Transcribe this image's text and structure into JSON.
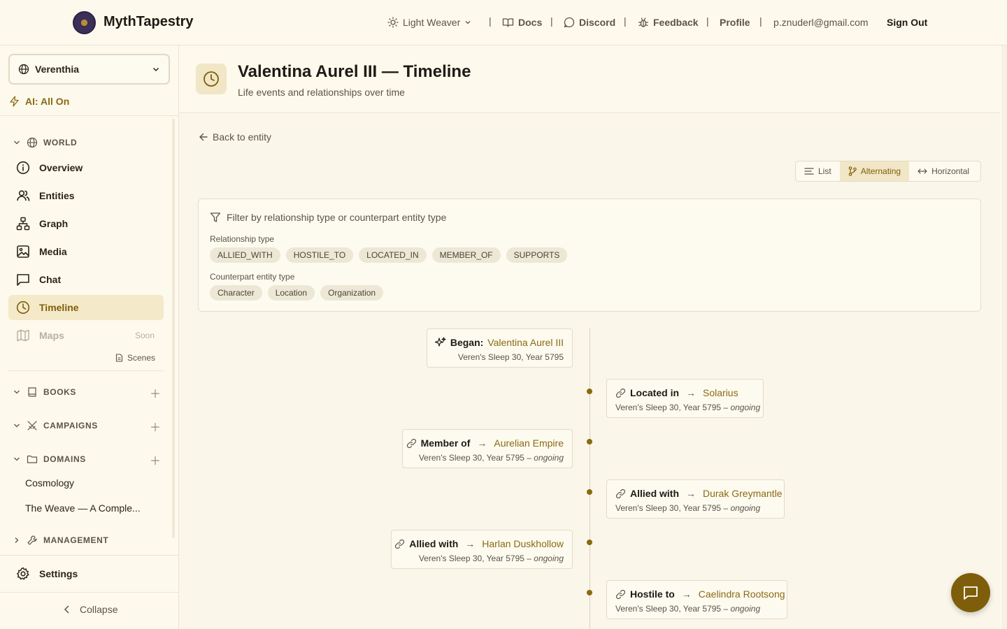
{
  "brand": {
    "name": "MythTapestry"
  },
  "topnav": {
    "theme": "Light Weaver",
    "docs": "Docs",
    "discord": "Discord",
    "feedback": "Feedback",
    "profile": "Profile",
    "email": "p.znuderl@gmail.com",
    "signout": "Sign Out",
    "separator": "|"
  },
  "sidebar": {
    "world": "Verenthia",
    "ai": "AI: All On",
    "world_section": "WORLD",
    "items": [
      {
        "label": "Overview",
        "icon": "info-icon"
      },
      {
        "label": "Entities",
        "icon": "users-icon"
      },
      {
        "label": "Graph",
        "icon": "graph-icon"
      },
      {
        "label": "Media",
        "icon": "image-icon"
      },
      {
        "label": "Chat",
        "icon": "chat-icon"
      },
      {
        "label": "Timeline",
        "icon": "clock-icon"
      },
      {
        "label": "Maps",
        "icon": "map-icon",
        "badge": "Soon"
      }
    ],
    "scenes": "Scenes",
    "books": "BOOKS",
    "campaigns": "CAMPAIGNS",
    "domains": "DOMAINS",
    "domain_items": [
      "Cosmology",
      "The Weave — A Comple..."
    ],
    "management": "MANAGEMENT",
    "settings": "Settings",
    "collapse": "Collapse"
  },
  "header": {
    "title": "Valentina Aurel III — Timeline",
    "subtitle": "Life events and relationships over time"
  },
  "back_link": "Back to entity",
  "view_modes": {
    "list": "List",
    "alternating": "Alternating",
    "horizontal": "Horizontal",
    "active": "Alternating"
  },
  "filter": {
    "title": "Filter by relationship type or counterpart entity type",
    "relationship_label": "Relationship type",
    "relationship_types": [
      "ALLIED_WITH",
      "HOSTILE_TO",
      "LOCATED_IN",
      "MEMBER_OF",
      "SUPPORTS"
    ],
    "entity_label": "Counterpart entity type",
    "entity_types": [
      "Character",
      "Location",
      "Organization"
    ]
  },
  "timeline": {
    "events": [
      {
        "side": "left",
        "kind": "Began:",
        "target": "Valentina Aurel III",
        "date": "Veren's Sleep 30, Year 5795",
        "ongoing": "",
        "icon": "sparkles-icon"
      },
      {
        "side": "right",
        "kind": "Located in",
        "arrow": "→",
        "target": "Solarius",
        "date": "Veren's Sleep 30, Year 5795 –",
        "ongoing": "ongoing",
        "icon": "link-icon"
      },
      {
        "side": "left",
        "kind": "Member of",
        "arrow": "→",
        "target": "Aurelian Empire",
        "date": "Veren's Sleep 30, Year 5795 –",
        "ongoing": "ongoing",
        "icon": "link-icon"
      },
      {
        "side": "right",
        "kind": "Allied with",
        "arrow": "→",
        "target": "Durak Greymantle",
        "date": "Veren's Sleep 30, Year 5795 –",
        "ongoing": "ongoing",
        "icon": "link-icon"
      },
      {
        "side": "left",
        "kind": "Allied with",
        "arrow": "→",
        "target": "Harlan Duskhollow",
        "date": "Veren's Sleep 30, Year 5795 –",
        "ongoing": "ongoing",
        "icon": "link-icon"
      },
      {
        "side": "right",
        "kind": "Hostile to",
        "arrow": "→",
        "target": "Caelindra Rootsong",
        "date": "Veren's Sleep 30, Year 5795 –",
        "ongoing": "ongoing",
        "icon": "link-icon"
      }
    ]
  },
  "colors": {
    "accent": "#8a6a10",
    "background": "#fdf9ec",
    "active_bg": "#f4e9c9"
  }
}
